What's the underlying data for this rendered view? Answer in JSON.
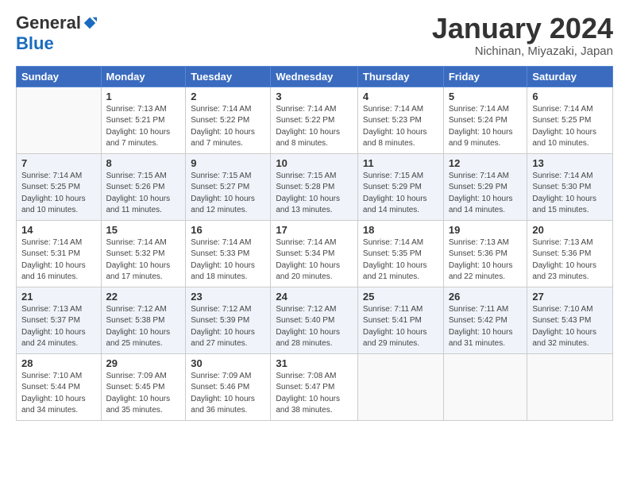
{
  "header": {
    "logo": {
      "part1": "General",
      "part2": "Blue"
    },
    "title": "January 2024",
    "subtitle": "Nichinan, Miyazaki, Japan"
  },
  "weekdays": [
    "Sunday",
    "Monday",
    "Tuesday",
    "Wednesday",
    "Thursday",
    "Friday",
    "Saturday"
  ],
  "weeks": [
    [
      {
        "day": "",
        "info": ""
      },
      {
        "day": "1",
        "info": "Sunrise: 7:13 AM\nSunset: 5:21 PM\nDaylight: 10 hours\nand 7 minutes."
      },
      {
        "day": "2",
        "info": "Sunrise: 7:14 AM\nSunset: 5:22 PM\nDaylight: 10 hours\nand 7 minutes."
      },
      {
        "day": "3",
        "info": "Sunrise: 7:14 AM\nSunset: 5:22 PM\nDaylight: 10 hours\nand 8 minutes."
      },
      {
        "day": "4",
        "info": "Sunrise: 7:14 AM\nSunset: 5:23 PM\nDaylight: 10 hours\nand 8 minutes."
      },
      {
        "day": "5",
        "info": "Sunrise: 7:14 AM\nSunset: 5:24 PM\nDaylight: 10 hours\nand 9 minutes."
      },
      {
        "day": "6",
        "info": "Sunrise: 7:14 AM\nSunset: 5:25 PM\nDaylight: 10 hours\nand 10 minutes."
      }
    ],
    [
      {
        "day": "7",
        "info": "Sunrise: 7:14 AM\nSunset: 5:25 PM\nDaylight: 10 hours\nand 10 minutes."
      },
      {
        "day": "8",
        "info": "Sunrise: 7:15 AM\nSunset: 5:26 PM\nDaylight: 10 hours\nand 11 minutes."
      },
      {
        "day": "9",
        "info": "Sunrise: 7:15 AM\nSunset: 5:27 PM\nDaylight: 10 hours\nand 12 minutes."
      },
      {
        "day": "10",
        "info": "Sunrise: 7:15 AM\nSunset: 5:28 PM\nDaylight: 10 hours\nand 13 minutes."
      },
      {
        "day": "11",
        "info": "Sunrise: 7:15 AM\nSunset: 5:29 PM\nDaylight: 10 hours\nand 14 minutes."
      },
      {
        "day": "12",
        "info": "Sunrise: 7:14 AM\nSunset: 5:29 PM\nDaylight: 10 hours\nand 14 minutes."
      },
      {
        "day": "13",
        "info": "Sunrise: 7:14 AM\nSunset: 5:30 PM\nDaylight: 10 hours\nand 15 minutes."
      }
    ],
    [
      {
        "day": "14",
        "info": "Sunrise: 7:14 AM\nSunset: 5:31 PM\nDaylight: 10 hours\nand 16 minutes."
      },
      {
        "day": "15",
        "info": "Sunrise: 7:14 AM\nSunset: 5:32 PM\nDaylight: 10 hours\nand 17 minutes."
      },
      {
        "day": "16",
        "info": "Sunrise: 7:14 AM\nSunset: 5:33 PM\nDaylight: 10 hours\nand 18 minutes."
      },
      {
        "day": "17",
        "info": "Sunrise: 7:14 AM\nSunset: 5:34 PM\nDaylight: 10 hours\nand 20 minutes."
      },
      {
        "day": "18",
        "info": "Sunrise: 7:14 AM\nSunset: 5:35 PM\nDaylight: 10 hours\nand 21 minutes."
      },
      {
        "day": "19",
        "info": "Sunrise: 7:13 AM\nSunset: 5:36 PM\nDaylight: 10 hours\nand 22 minutes."
      },
      {
        "day": "20",
        "info": "Sunrise: 7:13 AM\nSunset: 5:36 PM\nDaylight: 10 hours\nand 23 minutes."
      }
    ],
    [
      {
        "day": "21",
        "info": "Sunrise: 7:13 AM\nSunset: 5:37 PM\nDaylight: 10 hours\nand 24 minutes."
      },
      {
        "day": "22",
        "info": "Sunrise: 7:12 AM\nSunset: 5:38 PM\nDaylight: 10 hours\nand 25 minutes."
      },
      {
        "day": "23",
        "info": "Sunrise: 7:12 AM\nSunset: 5:39 PM\nDaylight: 10 hours\nand 27 minutes."
      },
      {
        "day": "24",
        "info": "Sunrise: 7:12 AM\nSunset: 5:40 PM\nDaylight: 10 hours\nand 28 minutes."
      },
      {
        "day": "25",
        "info": "Sunrise: 7:11 AM\nSunset: 5:41 PM\nDaylight: 10 hours\nand 29 minutes."
      },
      {
        "day": "26",
        "info": "Sunrise: 7:11 AM\nSunset: 5:42 PM\nDaylight: 10 hours\nand 31 minutes."
      },
      {
        "day": "27",
        "info": "Sunrise: 7:10 AM\nSunset: 5:43 PM\nDaylight: 10 hours\nand 32 minutes."
      }
    ],
    [
      {
        "day": "28",
        "info": "Sunrise: 7:10 AM\nSunset: 5:44 PM\nDaylight: 10 hours\nand 34 minutes."
      },
      {
        "day": "29",
        "info": "Sunrise: 7:09 AM\nSunset: 5:45 PM\nDaylight: 10 hours\nand 35 minutes."
      },
      {
        "day": "30",
        "info": "Sunrise: 7:09 AM\nSunset: 5:46 PM\nDaylight: 10 hours\nand 36 minutes."
      },
      {
        "day": "31",
        "info": "Sunrise: 7:08 AM\nSunset: 5:47 PM\nDaylight: 10 hours\nand 38 minutes."
      },
      {
        "day": "",
        "info": ""
      },
      {
        "day": "",
        "info": ""
      },
      {
        "day": "",
        "info": ""
      }
    ]
  ]
}
